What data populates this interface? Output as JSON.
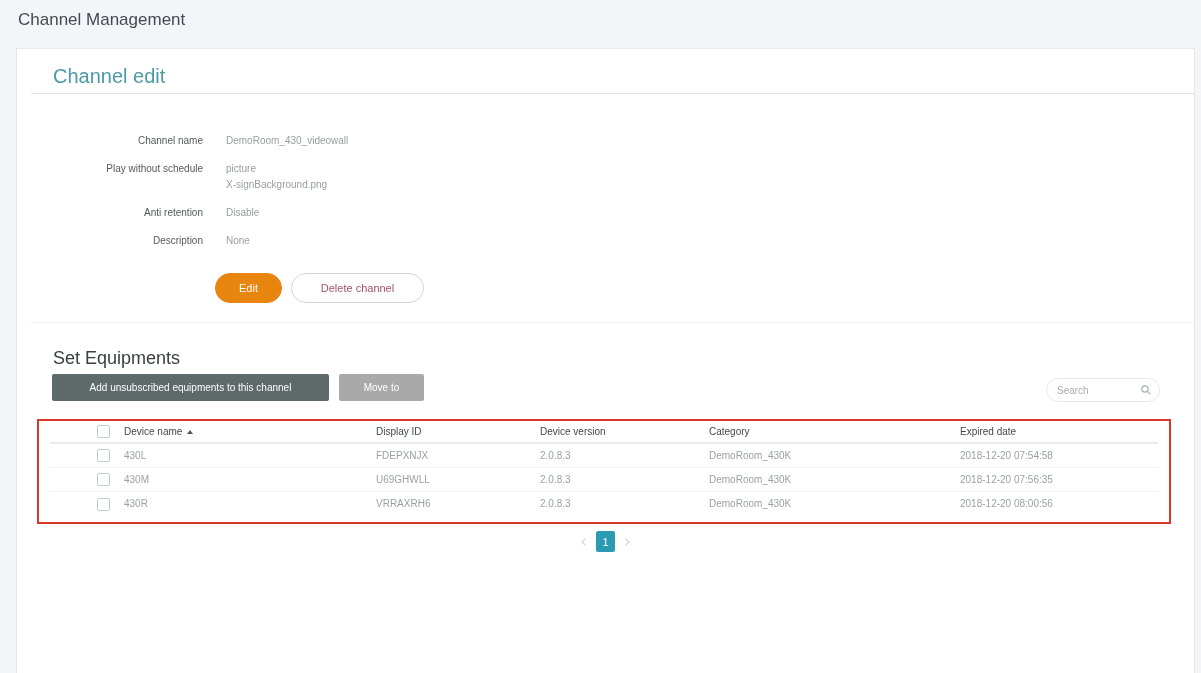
{
  "page": {
    "title": "Channel Management"
  },
  "channel_edit": {
    "title": "Channel edit",
    "fields": [
      {
        "label": "Channel name",
        "values": [
          "DemoRoom_430_videowall"
        ]
      },
      {
        "label": "Play without schedule",
        "values": [
          "picture",
          "X-signBackground.png"
        ]
      },
      {
        "label": "Anti retention",
        "values": [
          "Disable"
        ]
      },
      {
        "label": "Description",
        "values": [
          "None"
        ]
      }
    ],
    "buttons": [
      {
        "label": "Edit",
        "kind": "primary"
      },
      {
        "label": "Delete channel",
        "kind": "outline"
      }
    ]
  },
  "equipments": {
    "title": "Set Equipments",
    "buttons": [
      {
        "label": "Add unsubscribed equipments to this channel",
        "disabled": false
      },
      {
        "label": "Move to",
        "disabled": true
      }
    ],
    "search": {
      "placeholder": "Search"
    },
    "table": {
      "all_checked": false,
      "columns": [
        {
          "label": "Device name",
          "sorted": true
        },
        {
          "label": "Display ID",
          "sorted": false
        },
        {
          "label": "Device version",
          "sorted": false
        },
        {
          "label": "Category",
          "sorted": false
        },
        {
          "label": "Expired date",
          "sorted": false
        }
      ],
      "rows": [
        {
          "checked": false,
          "cells": [
            "430L",
            "FDEPXNJX",
            "2.0.8.3",
            "DemoRoom_430K",
            "2018-12-20 07:54:58"
          ]
        },
        {
          "checked": false,
          "cells": [
            "430M",
            "U69GHWLL",
            "2.0.8.3",
            "DemoRoom_430K",
            "2018-12-20 07:56:35"
          ]
        },
        {
          "checked": false,
          "cells": [
            "430R",
            "VRRAXRH6",
            "2.0.8.3",
            "DemoRoom_430K",
            "2018-12-20 08:00:56"
          ]
        }
      ]
    },
    "pagination": {
      "pages": [
        {
          "label": "1",
          "selected": true
        }
      ]
    }
  }
}
